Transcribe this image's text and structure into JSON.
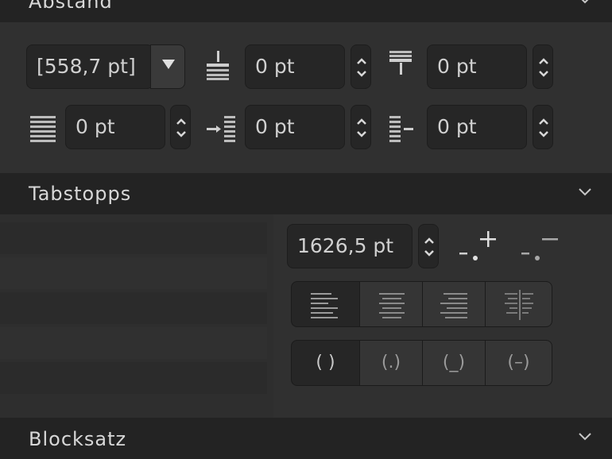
{
  "sections": {
    "abstand": {
      "title": "Abstand"
    },
    "tabstopps": {
      "title": "Tabstopps"
    },
    "blocksatz": {
      "title": "Blocksatz"
    }
  },
  "abstand": {
    "line_spacing": "[558,7 pt]",
    "space_before": "0 pt",
    "space_after": "0 pt",
    "baseline_grid": "0 pt",
    "indent_left": "0 pt",
    "indent_right": "0 pt"
  },
  "tabstopps": {
    "position": "1626,5 pt",
    "decimal_options": [
      "( )",
      "(.)",
      "(_)",
      "(–)"
    ]
  },
  "icons": {
    "line_spacing_dropdown": "triangle-down-icon",
    "space_before": "space-before-icon",
    "space_after": "space-after-icon",
    "baseline_grid": "baseline-grid-icon",
    "indent_left": "indent-left-icon",
    "indent_right": "indent-right-icon",
    "add_tab": "add-tab-icon",
    "remove_tab": "remove-tab-icon",
    "align_left": "align-left-icon",
    "align_center": "align-center-icon",
    "align_right": "align-right-icon",
    "align_decimal": "align-decimal-icon"
  }
}
